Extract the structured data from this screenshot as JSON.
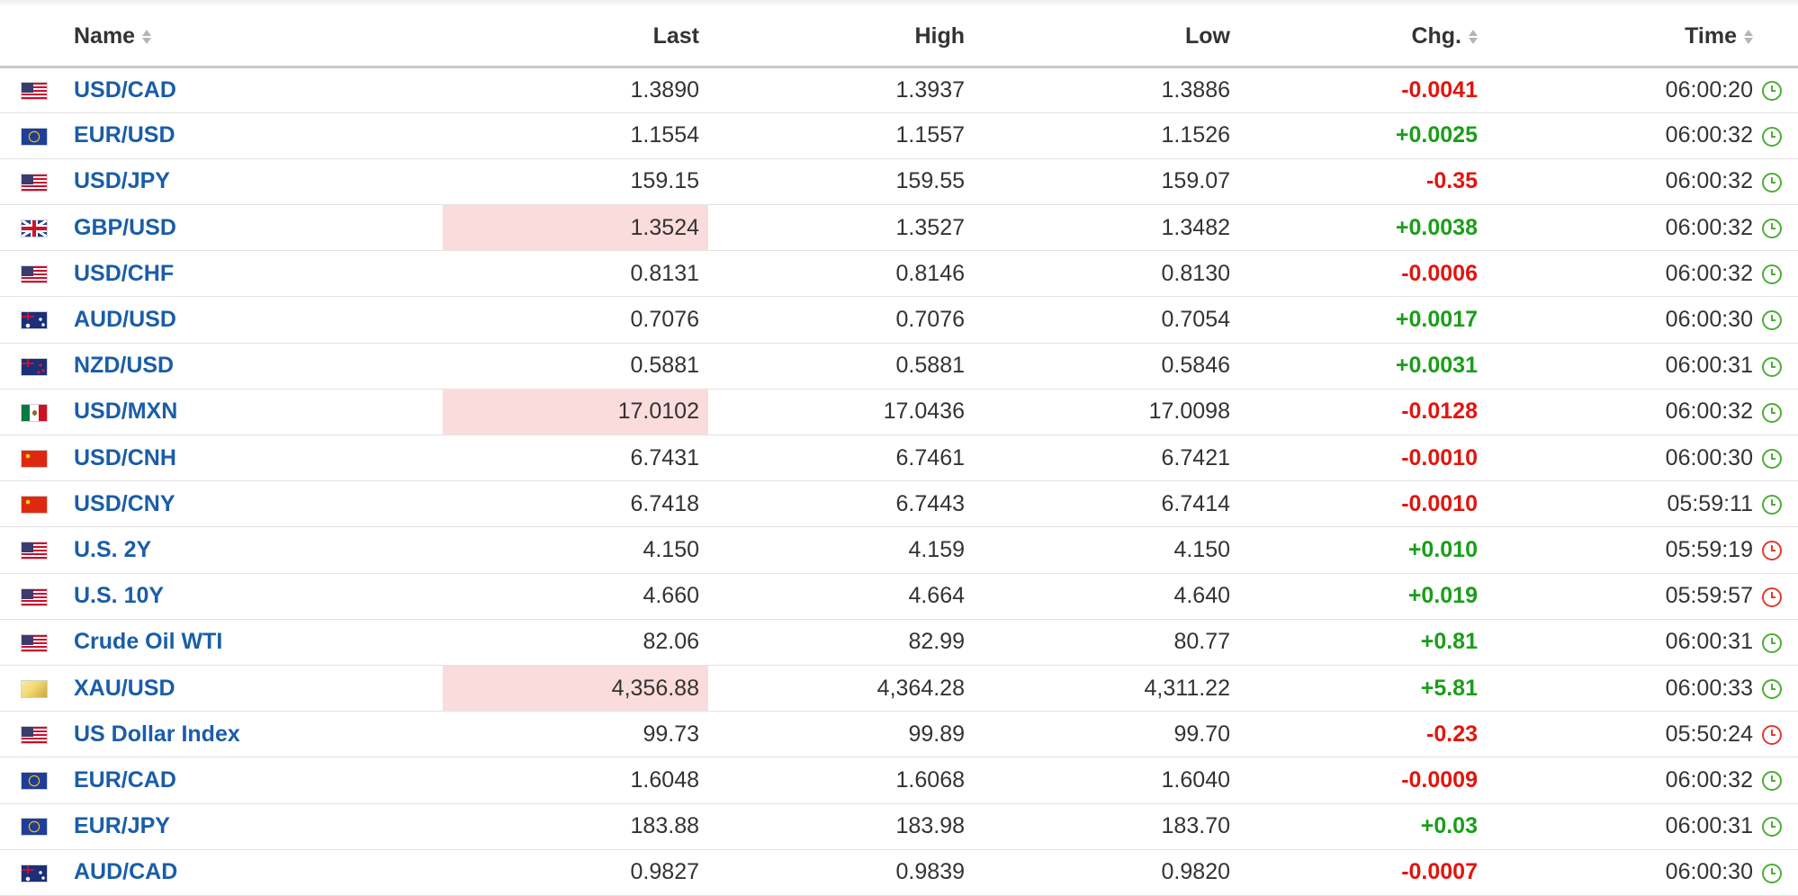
{
  "columns": {
    "name": "Name",
    "last": "Last",
    "high": "High",
    "low": "Low",
    "chg": "Chg.",
    "time": "Time"
  },
  "colors": {
    "link": "#1a5da8",
    "positive": "#1a9e1a",
    "negative": "#e0160f",
    "highlight": "#fbdcdc",
    "clock_ok": "#4cae34",
    "clock_delayed": "#e03a2f"
  },
  "rows": [
    {
      "flag": "us-flag",
      "name": "USD/CAD",
      "last": "1.3890",
      "high": "1.3937",
      "low": "1.3886",
      "chg": "-0.0041",
      "time": "06:00:20",
      "status": "green-clock-icon",
      "dir": "neg",
      "hl": false
    },
    {
      "flag": "eu-flag",
      "name": "EUR/USD",
      "last": "1.1554",
      "high": "1.1557",
      "low": "1.1526",
      "chg": "+0.0025",
      "time": "06:00:32",
      "status": "green-clock-icon",
      "dir": "pos",
      "hl": false
    },
    {
      "flag": "us-flag",
      "name": "USD/JPY",
      "last": "159.15",
      "high": "159.55",
      "low": "159.07",
      "chg": "-0.35",
      "time": "06:00:32",
      "status": "green-clock-icon",
      "dir": "neg",
      "hl": false
    },
    {
      "flag": "gb-flag",
      "name": "GBP/USD",
      "last": "1.3524",
      "high": "1.3527",
      "low": "1.3482",
      "chg": "+0.0038",
      "time": "06:00:32",
      "status": "green-clock-icon",
      "dir": "pos",
      "hl": true
    },
    {
      "flag": "us-flag",
      "name": "USD/CHF",
      "last": "0.8131",
      "high": "0.8146",
      "low": "0.8130",
      "chg": "-0.0006",
      "time": "06:00:32",
      "status": "green-clock-icon",
      "dir": "neg",
      "hl": false
    },
    {
      "flag": "au-flag",
      "name": "AUD/USD",
      "last": "0.7076",
      "high": "0.7076",
      "low": "0.7054",
      "chg": "+0.0017",
      "time": "06:00:30",
      "status": "green-clock-icon",
      "dir": "pos",
      "hl": false
    },
    {
      "flag": "nz-flag",
      "name": "NZD/USD",
      "last": "0.5881",
      "high": "0.5881",
      "low": "0.5846",
      "chg": "+0.0031",
      "time": "06:00:31",
      "status": "green-clock-icon",
      "dir": "pos",
      "hl": false
    },
    {
      "flag": "mx-flag",
      "name": "USD/MXN",
      "last": "17.0102",
      "high": "17.0436",
      "low": "17.0098",
      "chg": "-0.0128",
      "time": "06:00:32",
      "status": "green-clock-icon",
      "dir": "neg",
      "hl": true
    },
    {
      "flag": "cn-flag",
      "name": "USD/CNH",
      "last": "6.7431",
      "high": "6.7461",
      "low": "6.7421",
      "chg": "-0.0010",
      "time": "06:00:30",
      "status": "green-clock-icon",
      "dir": "neg",
      "hl": false
    },
    {
      "flag": "cn-flag",
      "name": "USD/CNY",
      "last": "6.7418",
      "high": "6.7443",
      "low": "6.7414",
      "chg": "-0.0010",
      "time": "05:59:11",
      "status": "green-clock-icon",
      "dir": "neg",
      "hl": false
    },
    {
      "flag": "us-flag",
      "name": "U.S. 2Y",
      "last": "4.150",
      "high": "4.159",
      "low": "4.150",
      "chg": "+0.010",
      "time": "05:59:19",
      "status": "red-clock-icon",
      "dir": "pos",
      "hl": false
    },
    {
      "flag": "us-flag",
      "name": "U.S. 10Y",
      "last": "4.660",
      "high": "4.664",
      "low": "4.640",
      "chg": "+0.019",
      "time": "05:59:57",
      "status": "red-clock-icon",
      "dir": "pos",
      "hl": false
    },
    {
      "flag": "us-flag",
      "name": "Crude Oil WTI",
      "last": "82.06",
      "high": "82.99",
      "low": "80.77",
      "chg": "+0.81",
      "time": "06:00:31",
      "status": "green-clock-icon",
      "dir": "pos",
      "hl": false
    },
    {
      "flag": "gold-bar-icon",
      "name": "XAU/USD",
      "last": "4,356.88",
      "high": "4,364.28",
      "low": "4,311.22",
      "chg": "+5.81",
      "time": "06:00:33",
      "status": "green-clock-icon",
      "dir": "pos",
      "hl": true
    },
    {
      "flag": "us-flag",
      "name": "US Dollar Index",
      "last": "99.73",
      "high": "99.89",
      "low": "99.70",
      "chg": "-0.23",
      "time": "05:50:24",
      "status": "red-clock-icon",
      "dir": "neg",
      "hl": false
    },
    {
      "flag": "eu-flag",
      "name": "EUR/CAD",
      "last": "1.6048",
      "high": "1.6068",
      "low": "1.6040",
      "chg": "-0.0009",
      "time": "06:00:32",
      "status": "green-clock-icon",
      "dir": "neg",
      "hl": false
    },
    {
      "flag": "eu-flag",
      "name": "EUR/JPY",
      "last": "183.88",
      "high": "183.98",
      "low": "183.70",
      "chg": "+0.03",
      "time": "06:00:31",
      "status": "green-clock-icon",
      "dir": "pos",
      "hl": false
    },
    {
      "flag": "au-flag",
      "name": "AUD/CAD",
      "last": "0.9827",
      "high": "0.9839",
      "low": "0.9820",
      "chg": "-0.0007",
      "time": "06:00:30",
      "status": "green-clock-icon",
      "dir": "neg",
      "hl": false
    }
  ]
}
